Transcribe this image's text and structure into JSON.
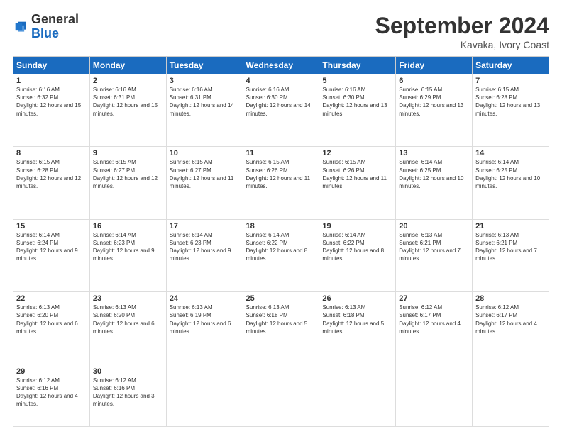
{
  "header": {
    "logo_general": "General",
    "logo_blue": "Blue",
    "month_title": "September 2024",
    "location": "Kavaka, Ivory Coast"
  },
  "days_of_week": [
    "Sunday",
    "Monday",
    "Tuesday",
    "Wednesday",
    "Thursday",
    "Friday",
    "Saturday"
  ],
  "weeks": [
    [
      {
        "day": "1",
        "sunrise": "6:16 AM",
        "sunset": "6:32 PM",
        "daylight": "12 hours and 15 minutes."
      },
      {
        "day": "2",
        "sunrise": "6:16 AM",
        "sunset": "6:31 PM",
        "daylight": "12 hours and 15 minutes."
      },
      {
        "day": "3",
        "sunrise": "6:16 AM",
        "sunset": "6:31 PM",
        "daylight": "12 hours and 14 minutes."
      },
      {
        "day": "4",
        "sunrise": "6:16 AM",
        "sunset": "6:30 PM",
        "daylight": "12 hours and 14 minutes."
      },
      {
        "day": "5",
        "sunrise": "6:16 AM",
        "sunset": "6:30 PM",
        "daylight": "12 hours and 13 minutes."
      },
      {
        "day": "6",
        "sunrise": "6:15 AM",
        "sunset": "6:29 PM",
        "daylight": "12 hours and 13 minutes."
      },
      {
        "day": "7",
        "sunrise": "6:15 AM",
        "sunset": "6:28 PM",
        "daylight": "12 hours and 13 minutes."
      }
    ],
    [
      {
        "day": "8",
        "sunrise": "6:15 AM",
        "sunset": "6:28 PM",
        "daylight": "12 hours and 12 minutes."
      },
      {
        "day": "9",
        "sunrise": "6:15 AM",
        "sunset": "6:27 PM",
        "daylight": "12 hours and 12 minutes."
      },
      {
        "day": "10",
        "sunrise": "6:15 AM",
        "sunset": "6:27 PM",
        "daylight": "12 hours and 11 minutes."
      },
      {
        "day": "11",
        "sunrise": "6:15 AM",
        "sunset": "6:26 PM",
        "daylight": "12 hours and 11 minutes."
      },
      {
        "day": "12",
        "sunrise": "6:15 AM",
        "sunset": "6:26 PM",
        "daylight": "12 hours and 11 minutes."
      },
      {
        "day": "13",
        "sunrise": "6:14 AM",
        "sunset": "6:25 PM",
        "daylight": "12 hours and 10 minutes."
      },
      {
        "day": "14",
        "sunrise": "6:14 AM",
        "sunset": "6:25 PM",
        "daylight": "12 hours and 10 minutes."
      }
    ],
    [
      {
        "day": "15",
        "sunrise": "6:14 AM",
        "sunset": "6:24 PM",
        "daylight": "12 hours and 9 minutes."
      },
      {
        "day": "16",
        "sunrise": "6:14 AM",
        "sunset": "6:23 PM",
        "daylight": "12 hours and 9 minutes."
      },
      {
        "day": "17",
        "sunrise": "6:14 AM",
        "sunset": "6:23 PM",
        "daylight": "12 hours and 9 minutes."
      },
      {
        "day": "18",
        "sunrise": "6:14 AM",
        "sunset": "6:22 PM",
        "daylight": "12 hours and 8 minutes."
      },
      {
        "day": "19",
        "sunrise": "6:14 AM",
        "sunset": "6:22 PM",
        "daylight": "12 hours and 8 minutes."
      },
      {
        "day": "20",
        "sunrise": "6:13 AM",
        "sunset": "6:21 PM",
        "daylight": "12 hours and 7 minutes."
      },
      {
        "day": "21",
        "sunrise": "6:13 AM",
        "sunset": "6:21 PM",
        "daylight": "12 hours and 7 minutes."
      }
    ],
    [
      {
        "day": "22",
        "sunrise": "6:13 AM",
        "sunset": "6:20 PM",
        "daylight": "12 hours and 6 minutes."
      },
      {
        "day": "23",
        "sunrise": "6:13 AM",
        "sunset": "6:20 PM",
        "daylight": "12 hours and 6 minutes."
      },
      {
        "day": "24",
        "sunrise": "6:13 AM",
        "sunset": "6:19 PM",
        "daylight": "12 hours and 6 minutes."
      },
      {
        "day": "25",
        "sunrise": "6:13 AM",
        "sunset": "6:18 PM",
        "daylight": "12 hours and 5 minutes."
      },
      {
        "day": "26",
        "sunrise": "6:13 AM",
        "sunset": "6:18 PM",
        "daylight": "12 hours and 5 minutes."
      },
      {
        "day": "27",
        "sunrise": "6:12 AM",
        "sunset": "6:17 PM",
        "daylight": "12 hours and 4 minutes."
      },
      {
        "day": "28",
        "sunrise": "6:12 AM",
        "sunset": "6:17 PM",
        "daylight": "12 hours and 4 minutes."
      }
    ],
    [
      {
        "day": "29",
        "sunrise": "6:12 AM",
        "sunset": "6:16 PM",
        "daylight": "12 hours and 4 minutes."
      },
      {
        "day": "30",
        "sunrise": "6:12 AM",
        "sunset": "6:16 PM",
        "daylight": "12 hours and 3 minutes."
      },
      null,
      null,
      null,
      null,
      null
    ]
  ]
}
